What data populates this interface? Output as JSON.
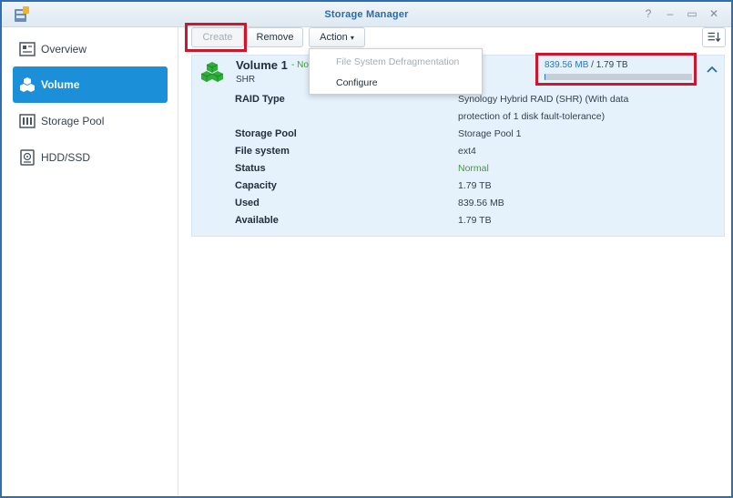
{
  "window": {
    "title": "Storage Manager",
    "controls": {
      "help": "?",
      "minimize": "–",
      "maximize": "▭",
      "close": "✕"
    }
  },
  "sidebar": {
    "items": [
      {
        "label": "Overview",
        "icon": "overview-icon",
        "active": false
      },
      {
        "label": "Volume",
        "icon": "volume-icon",
        "active": true
      },
      {
        "label": "Storage Pool",
        "icon": "storage-pool-icon",
        "active": false
      },
      {
        "label": "HDD/SSD",
        "icon": "hdd-icon",
        "active": false
      }
    ]
  },
  "toolbar": {
    "create_label": "Create",
    "remove_label": "Remove",
    "action_label": "Action",
    "action_caret": "▾"
  },
  "action_menu": {
    "items": [
      {
        "label": "File System Defragmentation",
        "enabled": false
      },
      {
        "label": "Configure",
        "enabled": true
      }
    ]
  },
  "volume": {
    "name": "Volume 1",
    "status_inline": "- No",
    "type": "SHR",
    "usage": {
      "used": "839.56 MB",
      "separator": " / ",
      "total": "1.79 TB",
      "fraction": 0.0005
    },
    "details": [
      {
        "label": "RAID Type",
        "value": "Synology Hybrid RAID (SHR) (With data protection of 1 disk fault-tolerance)"
      },
      {
        "label": "Storage Pool",
        "value": "Storage Pool 1"
      },
      {
        "label": "File system",
        "value": "ext4"
      },
      {
        "label": "Status",
        "value": "Normal"
      },
      {
        "label": "Capacity",
        "value": "1.79 TB"
      },
      {
        "label": "Used",
        "value": "839.56 MB"
      },
      {
        "label": "Available",
        "value": "1.79 TB"
      }
    ]
  },
  "colors": {
    "accent": "#1c8fd9",
    "title": "#2d6aa8",
    "status_ok": "#3aa02f",
    "highlight": "#d0152c",
    "volume_icon": "#2fae3a"
  }
}
